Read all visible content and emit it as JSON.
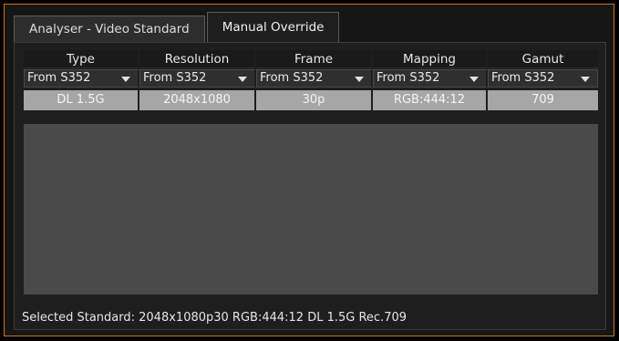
{
  "tabs": [
    {
      "label": "Analyser - Video Standard",
      "active": false
    },
    {
      "label": "Manual Override",
      "active": true
    }
  ],
  "table": {
    "columns": [
      "Type",
      "Resolution",
      "Frame",
      "Mapping",
      "Gamut"
    ],
    "dropdowns": [
      "From S352",
      "From S352",
      "From S352",
      "From S352",
      "From S352"
    ],
    "selected_row": [
      "DL 1.5G",
      "2048x1080",
      "30p",
      "RGB:444:12",
      "709"
    ]
  },
  "status": {
    "text": "Selected Standard: 2048x1080p30 RGB:444:12 DL 1.5G Rec.709"
  },
  "colors": {
    "accent_border": "#c97a12",
    "selected_row_bg": "#a6a6a6",
    "list_bg": "#4a4a4a"
  }
}
